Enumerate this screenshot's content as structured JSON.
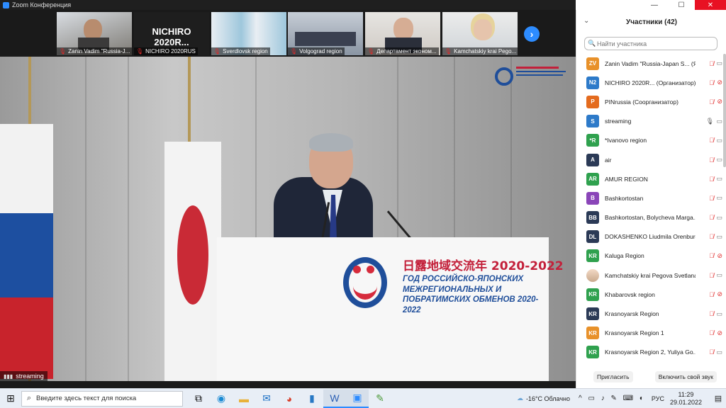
{
  "window": {
    "title": "Zoom Конференция",
    "controls": {
      "minimize": "—",
      "maximize": "☐",
      "close": "✕"
    }
  },
  "strip": {
    "tiles": [
      {
        "label": "Zanin Vadim \"Russia-J...",
        "muted": true,
        "type": "video"
      },
      {
        "label": "NICHIRO 2020RUS",
        "big": "NICHIRO 2020R...",
        "muted": true,
        "type": "nameonly"
      },
      {
        "label": "Sverdlovsk region",
        "muted": true,
        "type": "video"
      },
      {
        "label": "Volgograd region",
        "muted": true,
        "type": "video"
      },
      {
        "label": "Департамент эконом...",
        "muted": true,
        "type": "video"
      },
      {
        "label": "Kamchatskiy krai Pego...",
        "muted": true,
        "type": "video"
      }
    ],
    "next_icon": "›"
  },
  "main": {
    "label": "streaming",
    "podium_jp": "日露地域交流年 2020-2022",
    "podium_ru": "ГОД РОССИЙСКО-ЯПОНСКИХ\nМЕЖРЕГИОНАЛЬНЫХ И\nПОБРАТИМСКИХ ОБМЕНОВ 2020-2022"
  },
  "panel": {
    "title": "Участники (42)",
    "search_placeholder": "Найти участника",
    "participants": [
      {
        "initials": "ZV",
        "color": "#e8912a",
        "name": "Zanin Vadim \"Russia-Japan S... (Я)",
        "mic": "muted",
        "cam": "on"
      },
      {
        "initials": "N2",
        "color": "#2d7ac9",
        "name": "NICHIRO 2020R...  (Организатор)",
        "mic": "muted",
        "cam": "off"
      },
      {
        "initials": "P",
        "color": "#e46b1e",
        "name": "PINrussia (Соорганизатор)",
        "mic": "muted",
        "cam": "off"
      },
      {
        "initials": "S",
        "color": "#2d7ac9",
        "name": "streaming",
        "mic": "on",
        "cam": "on"
      },
      {
        "initials": "*R",
        "color": "#2fa14e",
        "name": "*Ivanovo region",
        "mic": "muted",
        "cam": "on"
      },
      {
        "initials": "A",
        "color": "#2b3a56",
        "name": "air",
        "mic": "muted",
        "cam": "on"
      },
      {
        "initials": "AR",
        "color": "#2fa14e",
        "name": "AMUR REGION",
        "mic": "muted",
        "cam": "on"
      },
      {
        "initials": "B",
        "color": "#8a45b8",
        "name": "Bashkortostan",
        "mic": "muted",
        "cam": "on"
      },
      {
        "initials": "BB",
        "color": "#2b3a56",
        "name": "Bashkortostan, Bolycheva Marga...",
        "mic": "muted",
        "cam": "on"
      },
      {
        "initials": "DL",
        "color": "#2b3a56",
        "name": "DOKASHENKO Liudmila Orenburg",
        "mic": "muted",
        "cam": "on"
      },
      {
        "initials": "KR",
        "color": "#2fa14e",
        "name": "Kaluga Region",
        "mic": "muted",
        "cam": "off"
      },
      {
        "initials": "",
        "color": "",
        "photo": true,
        "name": "Kamchatskiy krai Pegova Svetlana",
        "mic": "muted",
        "cam": "on"
      },
      {
        "initials": "KR",
        "color": "#2fa14e",
        "name": "Khabarovsk region",
        "mic": "muted",
        "cam": "off"
      },
      {
        "initials": "KR",
        "color": "#2b3a56",
        "name": "Krasnoyarsk Region",
        "mic": "muted",
        "cam": "on"
      },
      {
        "initials": "KR",
        "color": "#e8912a",
        "name": "Krasnoyarsk Region 1",
        "mic": "muted",
        "cam": "off"
      },
      {
        "initials": "KR",
        "color": "#2fa14e",
        "name": "Krasnoyarsk Region 2,  Yuliya Go...",
        "mic": "muted",
        "cam": "on"
      }
    ],
    "invite_label": "Пригласить",
    "unmute_label": "Включить свой звук"
  },
  "taskbar": {
    "search_placeholder": "Введите здесь текст для поиска",
    "weather": "-16°C  Облачно",
    "lang": "РУС",
    "time": "11:29",
    "date": "29.01.2022",
    "apps": [
      "task-view-icon",
      "edge-icon",
      "explorer-icon",
      "mail-icon",
      "chrome-icon",
      "files-icon",
      "word-icon",
      "zoom-icon",
      "paint-icon"
    ]
  }
}
